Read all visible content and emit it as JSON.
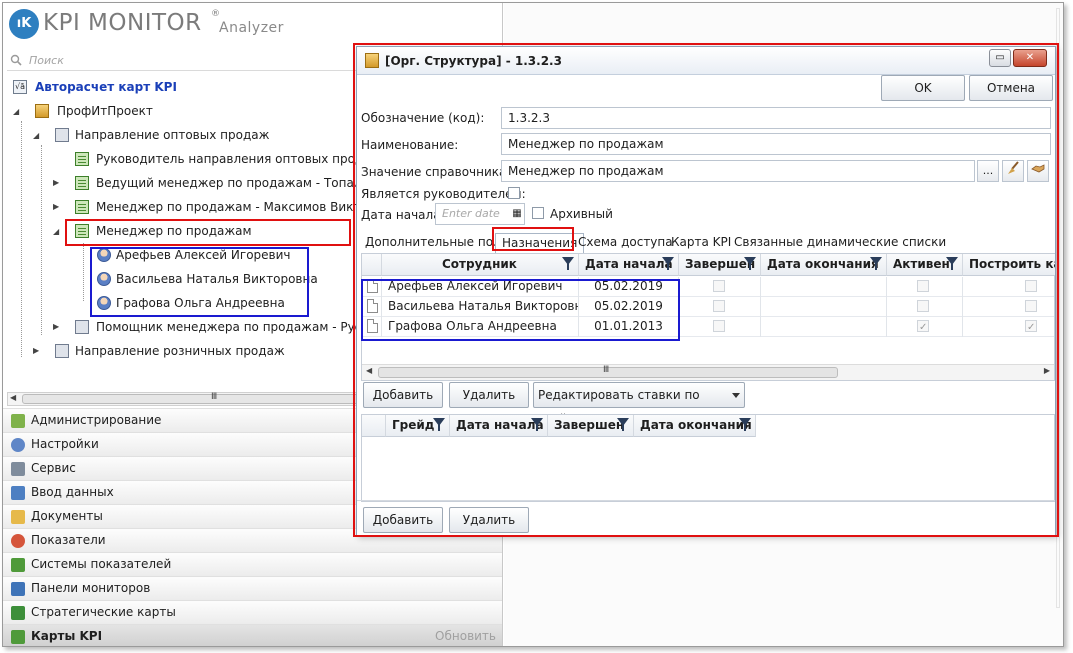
{
  "app": {
    "logo_badge": "ıK",
    "logo_title": "KPI MONITOR",
    "logo_reg": "®",
    "logo_subtitle": "Analyzer"
  },
  "search": {
    "placeholder": "Поиск"
  },
  "tree": {
    "root_label": "Авторасчет карт KPI",
    "org_label": "ПрофИтПроект",
    "dept_wholesale": "Направление оптовых продаж",
    "pos_head": "Руководитель направления оптовых продаж",
    "pos_lead": "Ведущий менеджер по продажам - Топалова В",
    "pos_manager_maximov": "Менеджер по продажам  - Максимов Виктор А",
    "pos_manager": "Менеджер по продажам",
    "people": [
      "Арефьев Алексей Игоревич",
      "Васильева Наталья Викторовна",
      "Графова Ольга Андреевна"
    ],
    "pos_assistant": "Помощник менеджера по продажам - Русаков",
    "dept_retail": "Направление розничных продаж"
  },
  "nav": [
    {
      "label": "Администрирование",
      "icon": "cube-icon",
      "color": "#7fb24a"
    },
    {
      "label": "Настройки",
      "icon": "gears-icon",
      "color": "#5f86c7"
    },
    {
      "label": "Сервис",
      "icon": "tools-icon",
      "color": "#7f8c9c"
    },
    {
      "label": "Ввод данных",
      "icon": "data-entry-icon",
      "color": "#4d7fc2"
    },
    {
      "label": "Документы",
      "icon": "folder-icon",
      "color": "#e6b94a"
    },
    {
      "label": "Показатели",
      "icon": "gauge-icon",
      "color": "#d5553b"
    },
    {
      "label": "Системы показателей",
      "icon": "hierarchy-icon",
      "color": "#4f9a3a"
    },
    {
      "label": "Панели мониторов",
      "icon": "dashboard-icon",
      "color": "#3f74b8"
    },
    {
      "label": "Стратегические карты",
      "icon": "strategy-map-icon",
      "color": "#3d8f3a"
    },
    {
      "label": "Карты KPI",
      "icon": "kpi-card-icon",
      "color": "#4f9a3a",
      "extra": "Обновить",
      "active": true
    }
  ],
  "dialog": {
    "title": "[Орг. Структура] - 1.3.2.3",
    "ok": "OK",
    "cancel": "Отмена",
    "win_minmax": "▭",
    "win_close": "✕",
    "code_label": "Обозначение (код):",
    "code_value": "1.3.2.3",
    "name_label": "Наименование:",
    "name_value": "Менеджер по продажам",
    "ref_label": "Значение справочника:",
    "ref_value": "Менеджер по продажам",
    "ref_btn_dots": "...",
    "is_head_label": "Является руководителем:",
    "start_date_label": "Дата начала",
    "start_date_placeholder": "Enter date",
    "archive_label": "Архивный",
    "tabs": [
      "Дополнительные поля",
      "Назначения",
      "Схема доступа",
      "Карта KPI",
      "Связанные динамические списки"
    ],
    "grid": {
      "columns": [
        "Сотрудник",
        "Дата начала",
        "Завершен",
        "Дата окончания",
        "Активен",
        "Построить карт"
      ],
      "rows": [
        {
          "employee": "Арефьев Алексей Игоревич",
          "start": "05.02.2019",
          "done": false,
          "end": "",
          "active": false,
          "build": false
        },
        {
          "employee": "Васильева Наталья Викторовна",
          "start": "05.02.2019",
          "done": false,
          "end": "",
          "active": false,
          "build": false
        },
        {
          "employee": "Графова Ольга Андреевна",
          "start": "01.01.2013",
          "done": false,
          "end": "",
          "active": true,
          "build": true
        }
      ]
    },
    "add_label": "Добавить",
    "delete_label": "Удалить",
    "edit_rates_label": "Редактировать ставки по грейдам",
    "grade_grid": {
      "columns": [
        "Грейд",
        "Дата начала",
        "Завершен",
        "Дата окончания"
      ]
    },
    "add2_label": "Добавить",
    "delete2_label": "Удалить"
  },
  "colors": {
    "annotation_red": "#e01010",
    "annotation_blue": "#1a1ad0",
    "accent": "#1a3fb8"
  }
}
